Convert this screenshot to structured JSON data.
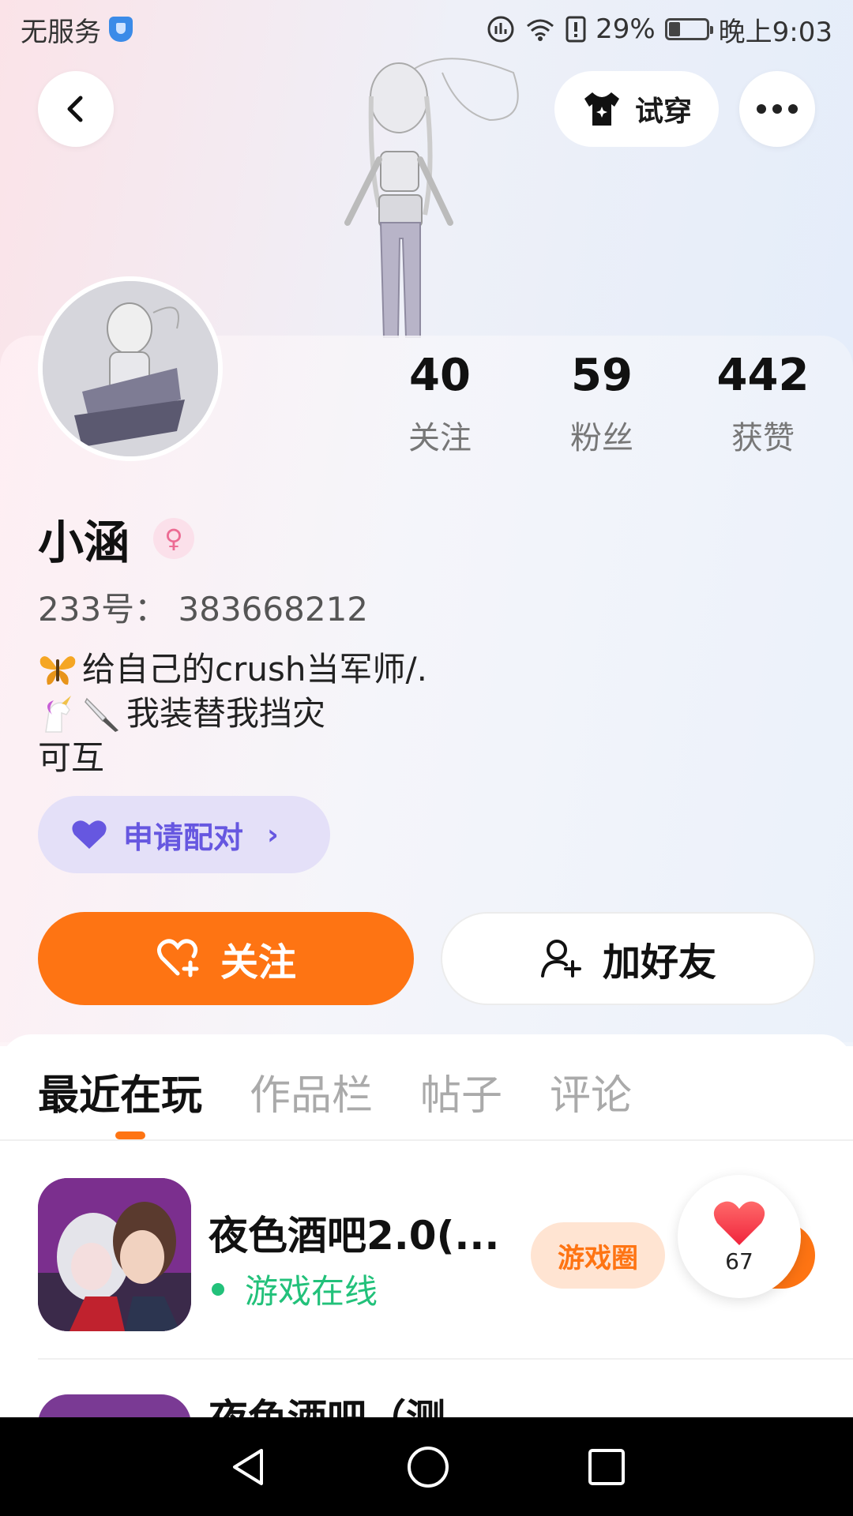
{
  "status_bar": {
    "carrier": "无服务",
    "battery_percent": "29%",
    "time": "晚上9:03"
  },
  "header": {
    "try_on_label": "试穿"
  },
  "profile": {
    "name": "小涵",
    "gender_symbol": "♀",
    "uid": "233号： 383668212",
    "bio_lines": [
      "给自己的crush当军师/.",
      "我装替我挡灾",
      "可互"
    ],
    "stats": [
      {
        "value": "40",
        "label": "关注"
      },
      {
        "value": "59",
        "label": "粉丝"
      },
      {
        "value": "442",
        "label": "获赞"
      }
    ]
  },
  "pair_button": {
    "label": "申请配对",
    "chevron": "›"
  },
  "actions": {
    "follow_label": "关注",
    "add_friend_label": "加好友"
  },
  "tabs": [
    {
      "label": "最近在玩",
      "active": true
    },
    {
      "label": "作品栏",
      "active": false
    },
    {
      "label": "帖子",
      "active": false
    },
    {
      "label": "评论",
      "active": false
    }
  ],
  "games": [
    {
      "title": "夜色酒吧2.0(...",
      "status": "游戏在线",
      "circle_label": "游戏圈"
    },
    {
      "title": "夜色酒吧（测"
    }
  ],
  "like_badge": {
    "count": "67"
  },
  "colors": {
    "accent": "#fe7413",
    "online": "#22c17a",
    "pair": "#6657e0"
  },
  "icons": [
    "back-icon",
    "tshirt-icon",
    "more-icon",
    "heart-icon",
    "heart-plus-icon",
    "user-plus-icon",
    "nav-back-icon",
    "nav-home-icon",
    "nav-recents-icon"
  ]
}
